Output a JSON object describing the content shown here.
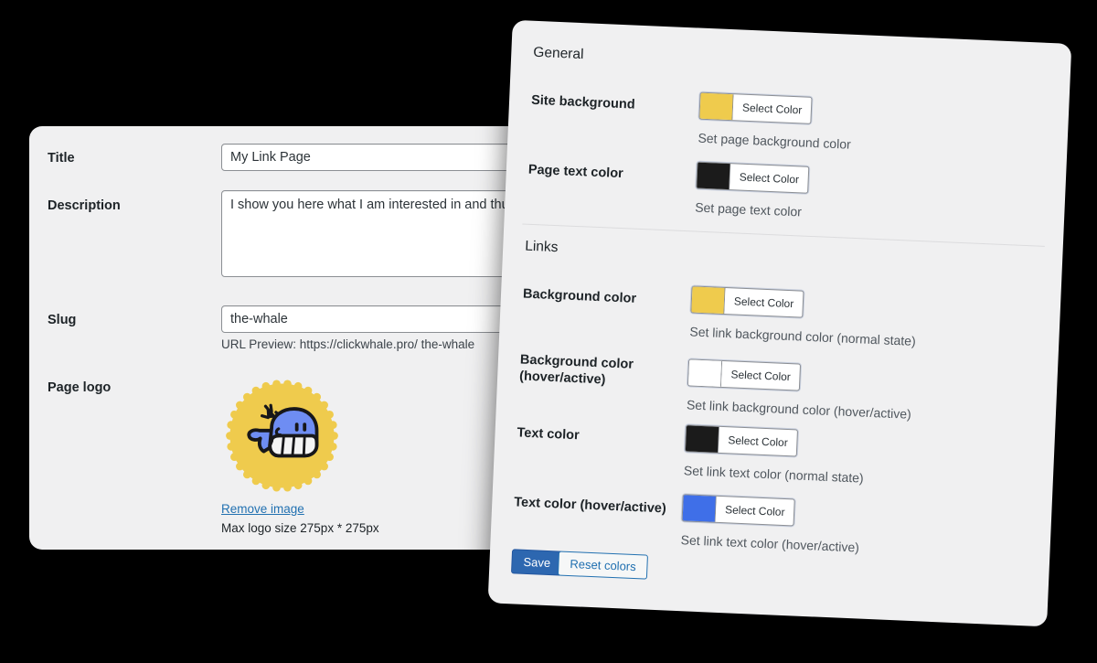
{
  "left_panel": {
    "title_label": "Title",
    "title_value": "My Link Page",
    "description_label": "Description",
    "description_value": "I show you here what I am interested in and thus enable",
    "slug_label": "Slug",
    "slug_value": "the-whale",
    "url_preview": "URL Preview: https://clickwhale.pro/ the-whale",
    "page_logo_label": "Page logo",
    "remove_image_label": "Remove image",
    "logo_note": "Max logo size 275px * 275px",
    "logo_icon": "whale-logo",
    "logo_circle_color": "#EFCB4D",
    "logo_body_color": "#6E8DF3",
    "panel_bg": "#F0F0F1"
  },
  "right_panel": {
    "general_heading": "General",
    "links_heading": "Links",
    "select_color_label": "Select Color",
    "general_rows": [
      {
        "label": "Site background",
        "hint": "Set page background color",
        "swatch": "#EFCB4D",
        "name": "site-background"
      },
      {
        "label": "Page text color",
        "hint": "Set page text color",
        "swatch": "#1B1B1B",
        "name": "page-text-color"
      }
    ],
    "links_rows": [
      {
        "label": "Background color",
        "hint": "Set link background color (normal state)",
        "swatch": "#EFCB4D",
        "name": "link-background-color"
      },
      {
        "label": "Background color (hover/active)",
        "hint": "Set link background color (hover/active)",
        "swatch": "#FFFFFF",
        "name": "link-background-color-hover"
      },
      {
        "label": "Text color",
        "hint": "Set link text color (normal state)",
        "swatch": "#1B1B1B",
        "name": "link-text-color"
      },
      {
        "label": "Text color (hover/active)",
        "hint": "Set link text color (hover/active)",
        "swatch": "#3F6FE8",
        "name": "link-text-color-hover"
      }
    ],
    "save_label": "Save",
    "reset_label": "Reset colors",
    "save_color": "#2d67b0",
    "reset_border_color": "#2271b1",
    "panel_bg": "#F0F0F1"
  }
}
